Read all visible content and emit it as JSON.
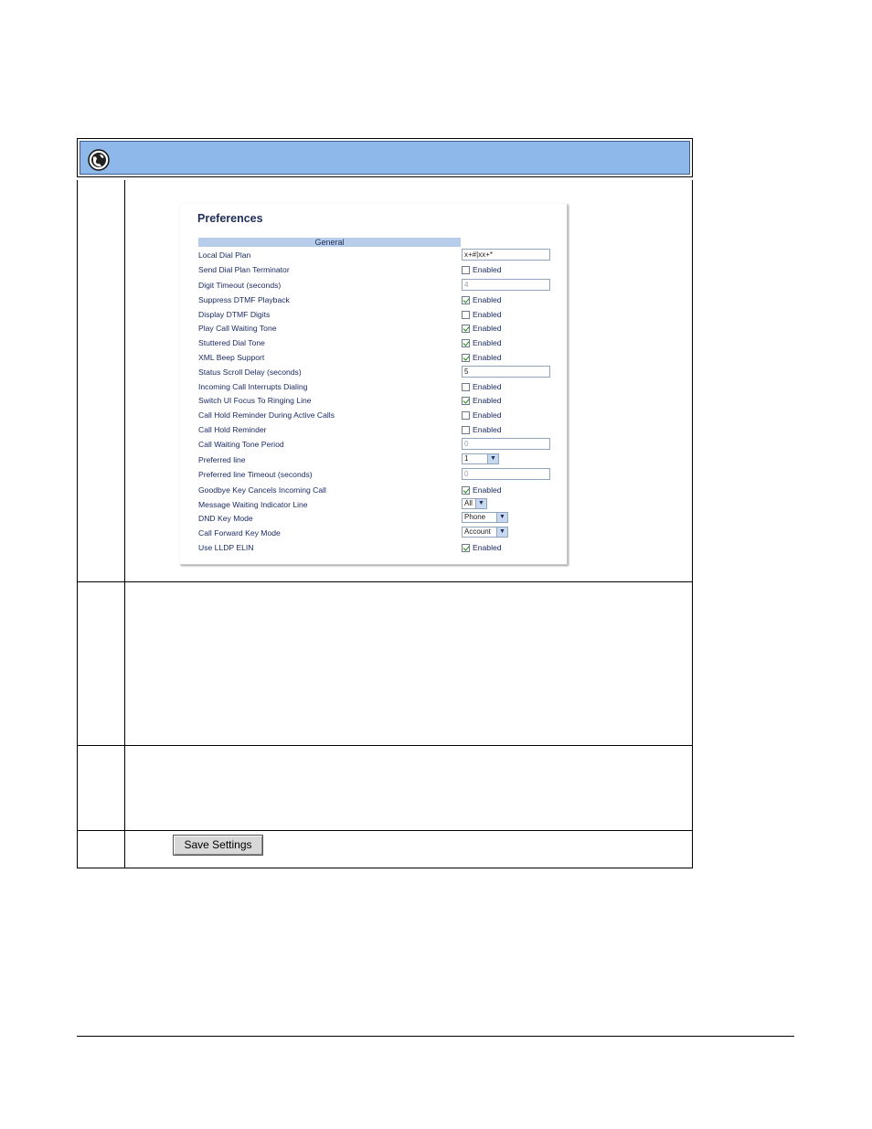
{
  "panel": {
    "title": "Preferences",
    "section": "General",
    "rows": [
      {
        "label": "Local Dial Plan",
        "type": "text",
        "value": "x+#|xx+*"
      },
      {
        "label": "Send Dial Plan Terminator",
        "type": "checkbox",
        "checked": false,
        "text": "Enabled"
      },
      {
        "label": "Digit Timeout (seconds)",
        "type": "text",
        "value": "4",
        "dim": true
      },
      {
        "label": "Suppress DTMF Playback",
        "type": "checkbox",
        "checked": true,
        "text": "Enabled"
      },
      {
        "label": "Display DTMF Digits",
        "type": "checkbox",
        "checked": false,
        "text": "Enabled"
      },
      {
        "label": "Play Call Waiting Tone",
        "type": "checkbox",
        "checked": true,
        "text": "Enabled"
      },
      {
        "label": "Stuttered Dial Tone",
        "type": "checkbox",
        "checked": true,
        "text": "Enabled"
      },
      {
        "label": "XML Beep Support",
        "type": "checkbox",
        "checked": true,
        "text": "Enabled"
      },
      {
        "label": "Status Scroll Delay (seconds)",
        "type": "text",
        "value": "5"
      },
      {
        "label": "Incoming Call Interrupts Dialing",
        "type": "checkbox",
        "checked": false,
        "text": "Enabled"
      },
      {
        "label": "Switch UI Focus To Ringing Line",
        "type": "checkbox",
        "checked": true,
        "text": "Enabled"
      },
      {
        "label": "Call Hold Reminder During Active Calls",
        "type": "checkbox",
        "checked": false,
        "text": "Enabled"
      },
      {
        "label": "Call Hold Reminder",
        "type": "checkbox",
        "checked": false,
        "text": "Enabled"
      },
      {
        "label": "Call Waiting Tone Period",
        "type": "text",
        "value": "0",
        "dim": true
      },
      {
        "label": "Preferred line",
        "type": "select",
        "value": "1"
      },
      {
        "label": "Preferred line Timeout (seconds)",
        "type": "text",
        "value": "0",
        "dim": true
      },
      {
        "label": "Goodbye Key Cancels Incoming Call",
        "type": "checkbox",
        "checked": true,
        "text": "Enabled"
      },
      {
        "label": "Message Waiting Indicator Line",
        "type": "select",
        "value": "All"
      },
      {
        "label": "DND Key Mode",
        "type": "select",
        "value": "Phone"
      },
      {
        "label": "Call Forward Key Mode",
        "type": "select",
        "value": "Account"
      },
      {
        "label": "Use LLDP ELIN",
        "type": "checkbox",
        "checked": true,
        "text": "Enabled"
      }
    ]
  },
  "save_button": "Save Settings",
  "icons": {
    "header": "globe-icon"
  },
  "colors": {
    "header_bar": "#8eb8ea",
    "section_band": "#b8cde9",
    "label_text": "#1c2b63"
  }
}
